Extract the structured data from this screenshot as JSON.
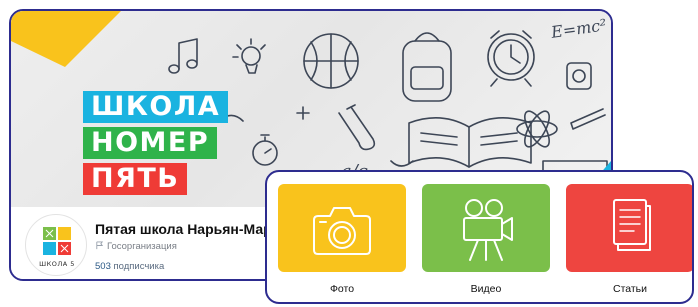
{
  "colors": {
    "frame": "#2d2c8f",
    "accent_yellow": "#f9c31c",
    "accent_cyan": "#1ab3e0",
    "title_blue": "#1ab3e0",
    "title_green": "#2fb34a",
    "title_red": "#ef3b36",
    "tile_photo": "#f9c31c",
    "tile_video": "#7bbf4a",
    "tile_articles": "#ee4540"
  },
  "cover": {
    "title_lines": [
      "ШКОЛА",
      "НОМЕР",
      "ПЯТЬ"
    ],
    "doodle_formula": "E=mc²",
    "doodle_expression": "a/c"
  },
  "profile": {
    "avatar_label": "ШКОЛА 5",
    "name": "Пятая школа Нарьян-Мар",
    "type": "Госорганизация",
    "followers_count": "503",
    "followers_label": "подписчика"
  },
  "media": {
    "tiles": [
      {
        "label": "Фото",
        "icon": "camera-icon"
      },
      {
        "label": "Видео",
        "icon": "film-camera-icon"
      },
      {
        "label": "Статьи",
        "icon": "document-icon"
      }
    ]
  }
}
